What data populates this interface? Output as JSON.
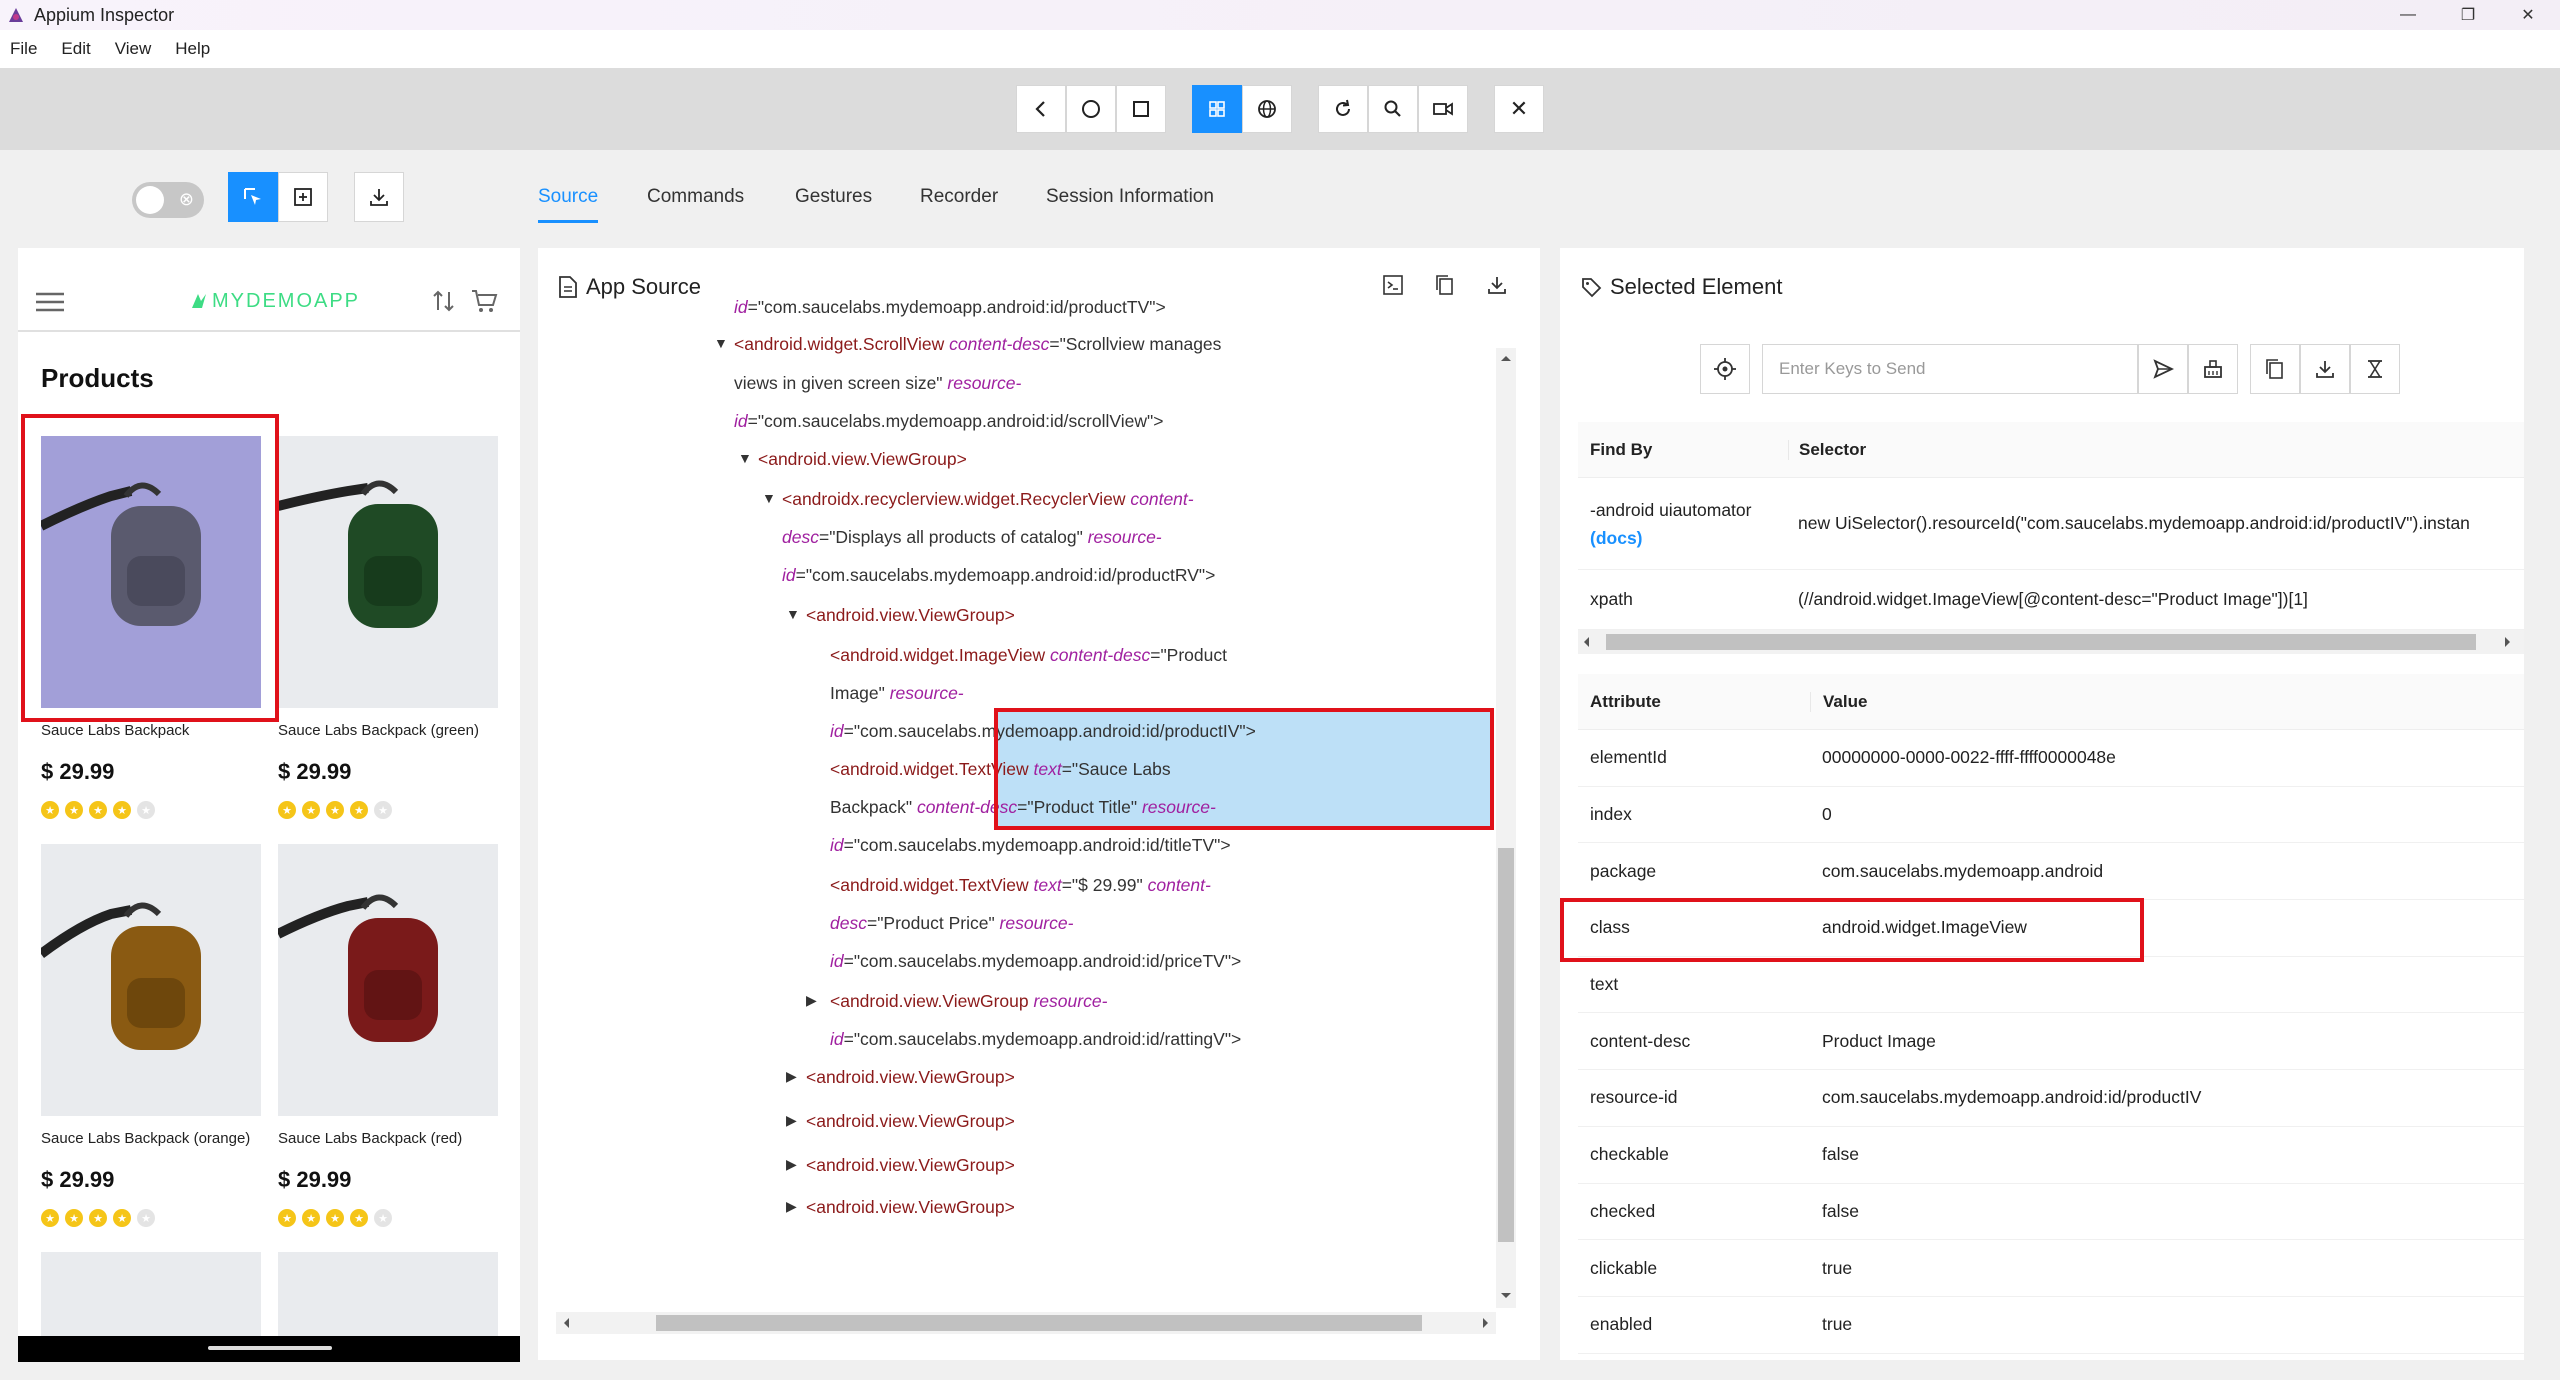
{
  "window": {
    "title": "Appium Inspector"
  },
  "menu": [
    "File",
    "Edit",
    "View",
    "Help"
  ],
  "toolbar": {
    "close_label": "✕"
  },
  "tabs": [
    "Source",
    "Commands",
    "Gestures",
    "Recorder",
    "Session Information"
  ],
  "device": {
    "brand": "MYDEMOAPP",
    "heading": "Products",
    "products": [
      {
        "name": "Sauce Labs Backpack",
        "price": "$ 29.99",
        "rating": 4,
        "color": "#5a5a6e"
      },
      {
        "name": "Sauce Labs Backpack (green)",
        "price": "$ 29.99",
        "rating": 4,
        "color": "#1f4a25"
      },
      {
        "name": "Sauce Labs Backpack (orange)",
        "price": "$ 29.99",
        "rating": 4,
        "color": "#8a5a12"
      },
      {
        "name": "Sauce Labs Backpack (red)",
        "price": "$ 29.99",
        "rating": 4,
        "color": "#7a1a1a"
      }
    ]
  },
  "source": {
    "title": "App Source",
    "lines": [
      {
        "arrow": "",
        "tag": "",
        "attr1": "id",
        "val1": "=\"com.saucelabs.mydemoapp.android:id/productTV\">"
      },
      {
        "arrow": "▼",
        "tag": "<android.widget.ScrollView ",
        "attr1": "content-desc",
        "val1": "=\"Scrollview manages"
      },
      {
        "arrow": "",
        "tag": "",
        "attr1": "",
        "val1": "views in given screen size\" ",
        "attr2": "resource-"
      },
      {
        "arrow": "",
        "tag": "",
        "attr1": "id",
        "val1": "=\"com.saucelabs.mydemoapp.android:id/scrollView\">"
      },
      {
        "arrow": "▼",
        "tag": "<android.view.ViewGroup>",
        "attr1": "",
        "val1": ""
      },
      {
        "arrow": "▼",
        "tag": "<androidx.recyclerview.widget.RecyclerView ",
        "attr1": "content-",
        "val1": ""
      },
      {
        "arrow": "",
        "tag": "",
        "attr1": "desc",
        "val1": "=\"Displays all products of catalog\" ",
        "attr2": "resource-"
      },
      {
        "arrow": "",
        "tag": "",
        "attr1": "id",
        "val1": "=\"com.saucelabs.mydemoapp.android:id/productRV\">"
      },
      {
        "arrow": "▼",
        "tag": "<android.view.ViewGroup>",
        "attr1": "",
        "val1": ""
      },
      {
        "arrow": "",
        "tag": "<android.widget.ImageView ",
        "attr1": "content-desc",
        "val1": "=\"Product"
      },
      {
        "arrow": "",
        "tag": "",
        "attr1": "",
        "val1": "Image\" ",
        "attr2": "resource-"
      },
      {
        "arrow": "",
        "tag": "",
        "attr1": "id",
        "val1": "=\"com.saucelabs.mydemoapp.android:id/productIV\">"
      },
      {
        "arrow": "",
        "tag": "<android.widget.TextView ",
        "attr1": "text",
        "val1": "=\"Sauce Labs"
      },
      {
        "arrow": "",
        "tag": "",
        "attr1": "",
        "val1": "Backpack\" ",
        "attr2": "content-desc",
        "val2": "=\"Product Title\" ",
        "attr3": "resource-"
      },
      {
        "arrow": "",
        "tag": "",
        "attr1": "id",
        "val1": "=\"com.saucelabs.mydemoapp.android:id/titleTV\">"
      },
      {
        "arrow": "",
        "tag": "<android.widget.TextView ",
        "attr1": "text",
        "val1": "=\"$ 29.99\" ",
        "attr2": "content-"
      },
      {
        "arrow": "",
        "tag": "",
        "attr1": "desc",
        "val1": "=\"Product Price\" ",
        "attr2": "resource-"
      },
      {
        "arrow": "",
        "tag": "",
        "attr1": "id",
        "val1": "=\"com.saucelabs.mydemoapp.android:id/priceTV\">"
      },
      {
        "arrow": "▶",
        "tag": "<android.view.ViewGroup ",
        "attr1": "resource-",
        "val1": ""
      },
      {
        "arrow": "",
        "tag": "",
        "attr1": "id",
        "val1": "=\"com.saucelabs.mydemoapp.android:id/rattingV\">"
      },
      {
        "arrow": "▶",
        "tag": "<android.view.ViewGroup>",
        "attr1": "",
        "val1": ""
      },
      {
        "arrow": "▶",
        "tag": "<android.view.ViewGroup>",
        "attr1": "",
        "val1": ""
      },
      {
        "arrow": "▶",
        "tag": "<android.view.ViewGroup>",
        "attr1": "",
        "val1": ""
      },
      {
        "arrow": "▶",
        "tag": "<android.view.ViewGroup>",
        "attr1": "",
        "val1": ""
      }
    ]
  },
  "selected": {
    "title": "Selected Element",
    "keys_placeholder": "Enter Keys to Send",
    "find_by_header": "Find By",
    "selector_header": "Selector",
    "locators": [
      {
        "by": "-android uiautomator",
        "link": "(docs)",
        "selector": "new UiSelector().resourceId(\"com.saucelabs.mydemoapp.android:id/productIV\").instan"
      },
      {
        "by": "xpath",
        "link": "",
        "selector": "(//android.widget.ImageView[@content-desc=\"Product Image\"])[1]"
      }
    ],
    "attribute_header": "Attribute",
    "value_header": "Value",
    "attributes": [
      {
        "name": "elementId",
        "value": "00000000-0000-0022-ffff-ffff0000048e"
      },
      {
        "name": "index",
        "value": "0"
      },
      {
        "name": "package",
        "value": "com.saucelabs.mydemoapp.android"
      },
      {
        "name": "class",
        "value": "android.widget.ImageView"
      },
      {
        "name": "text",
        "value": ""
      },
      {
        "name": "content-desc",
        "value": "Product Image"
      },
      {
        "name": "resource-id",
        "value": "com.saucelabs.mydemoapp.android:id/productIV"
      },
      {
        "name": "checkable",
        "value": "false"
      },
      {
        "name": "checked",
        "value": "false"
      },
      {
        "name": "clickable",
        "value": "true"
      },
      {
        "name": "enabled",
        "value": "true"
      }
    ]
  },
  "colors": {
    "accent": "#1890ff",
    "highlight": "#bde0f7",
    "red_box": "#e0111a",
    "brand": "#3ddc84"
  }
}
